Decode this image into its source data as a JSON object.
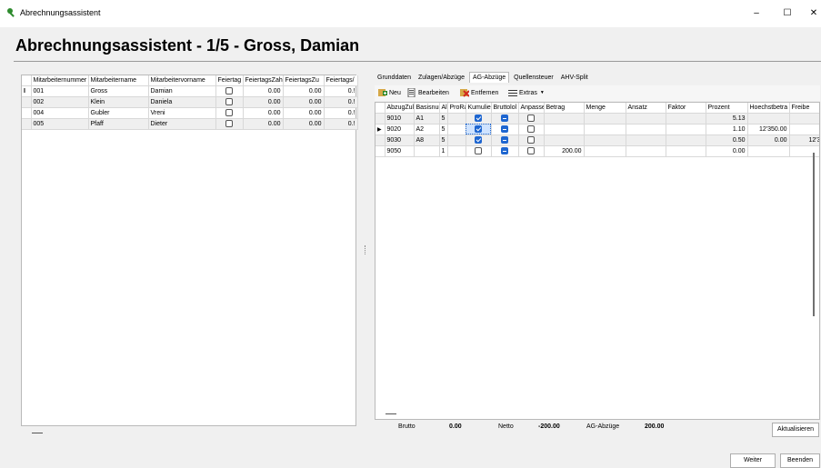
{
  "window": {
    "title": "Abrechnungsassistent",
    "controls": [
      "–",
      "☐",
      "✕"
    ]
  },
  "heading": "Abrechnungsassistent - 1/5 - Gross, Damian",
  "employees": {
    "columns": [
      "Mitarbeiternummer",
      "Mitarbeitername",
      "Mitarbeitervorname",
      "Feiertag",
      "FeiertagsZah",
      "FeiertagsZu",
      "Feiertags/"
    ],
    "row_indicator": "I",
    "rows": [
      {
        "nr": "001",
        "name": "Gross",
        "vorname": "Damian",
        "feiertag": false,
        "zah": "0.00",
        "zu": "0.00",
        "rest": "0.!"
      },
      {
        "nr": "002",
        "name": "Klein",
        "vorname": "Daniela",
        "feiertag": false,
        "zah": "0.00",
        "zu": "0.00",
        "rest": "0.!"
      },
      {
        "nr": "004",
        "name": "Gubler",
        "vorname": "Vreni",
        "feiertag": false,
        "zah": "0.00",
        "zu": "0.00",
        "rest": "0.!"
      },
      {
        "nr": "005",
        "name": "Pfaff",
        "vorname": "Dieter",
        "feiertag": false,
        "zah": "0.00",
        "zu": "0.00",
        "rest": "0.!"
      }
    ]
  },
  "tabs": [
    {
      "label": "Grunddaten",
      "active": false
    },
    {
      "label": "Zulagen/Abzüge",
      "active": false
    },
    {
      "label": "AG-Abzüge",
      "active": true
    },
    {
      "label": "Quellensteuer",
      "active": false
    },
    {
      "label": "AHV-Split",
      "active": false
    }
  ],
  "toolbar": {
    "neu": "Neu",
    "bearbeiten": "Bearbeiten",
    "entfernen": "Entfernen",
    "extras": "Extras"
  },
  "deductions": {
    "columns": [
      "AbzugZul",
      "Basisnur",
      "Al",
      "ProRa",
      "Kumulier",
      "Bruttolol",
      "Anpasse",
      "Betrag",
      "Menge",
      "Ansatz",
      "Faktor",
      "Prozent",
      "Hoechstbetra",
      "Freibe"
    ],
    "rows": [
      {
        "code": "9010",
        "basis": "A1",
        "al": "5",
        "kum": "on",
        "brutto": "ind",
        "anp": "off",
        "betrag": "",
        "prozent": "5.13",
        "hoechst": "",
        "frei": "",
        "current": false
      },
      {
        "code": "9020",
        "basis": "A2",
        "al": "5",
        "kum": "on",
        "brutto": "ind",
        "anp": "off",
        "betrag": "",
        "prozent": "1.10",
        "hoechst": "12'350.00",
        "frei": "",
        "current": true
      },
      {
        "code": "9030",
        "basis": "A8",
        "al": "5",
        "kum": "on",
        "brutto": "ind",
        "anp": "off",
        "betrag": "",
        "prozent": "0.50",
        "hoechst": "0.00",
        "frei": "12'3",
        "current": false
      },
      {
        "code": "9050",
        "basis": "",
        "al": "1",
        "kum": "off",
        "brutto": "ind",
        "anp": "off",
        "betrag": "200.00",
        "prozent": "0.00",
        "hoechst": "",
        "frei": "",
        "current": false
      }
    ]
  },
  "summary": {
    "brutto_label": "Brutto",
    "brutto": "0.00",
    "netto_label": "Netto",
    "netto": "-200.00",
    "ag_label": "AG-Abzüge",
    "ag": "200.00"
  },
  "buttons": {
    "aktualisieren": "Aktualisieren",
    "weiter": "Weiter",
    "beenden": "Beenden"
  },
  "colors": {
    "accent": "#1e66d0",
    "title_icon": "#2e8b2e"
  }
}
